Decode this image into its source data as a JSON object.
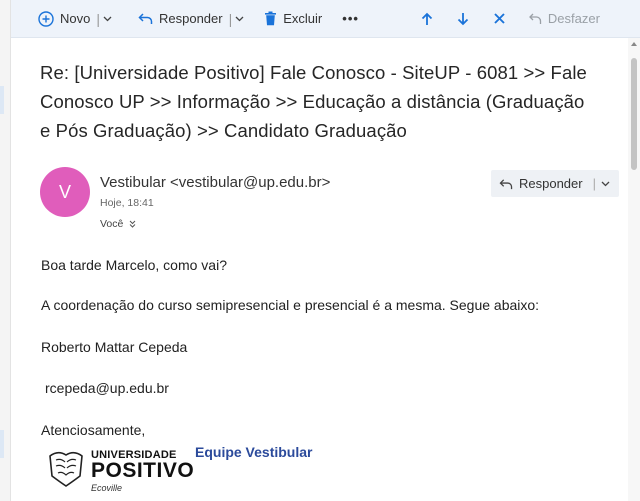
{
  "toolbar": {
    "new_label": "Novo",
    "reply_label": "Responder",
    "delete_label": "Excluir",
    "more_label": "•••",
    "undo_label": "Desfazer",
    "separator": "|"
  },
  "message": {
    "subject": "Re: [Universidade Positivo] Fale Conosco - SiteUP - 6081 >> Fale Conosco UP >> Informação >> Educação a distância (Graduação e Pós Graduação) >> Candidato Graduação",
    "avatar_initial": "V",
    "avatar_color": "#e05dbb",
    "sender": "Vestibular <vestibular@up.edu.br>",
    "time": "Hoje, 18:41",
    "to": "Você",
    "reply_button_label": "Responder"
  },
  "body": {
    "greeting": "Boa tarde Marcelo, como vai?",
    "paragraph": "A coordenação do curso semipresencial e presencial é a mesma. Segue abaixo:",
    "contact_name": "Roberto Mattar Cepeda",
    "contact_email": "rcepeda@up.edu.br",
    "closing": "Atenciosamente,"
  },
  "signature": {
    "logo_line1": "UNIVERSIDADE",
    "logo_line2": "POSITIVO",
    "logo_line3": "Ecoville",
    "team": "Equipe Vestibular",
    "team_color": "#2b4a9b"
  },
  "colors": {
    "accent": "#1a73d9",
    "toolbar_bg": "#eef3fa"
  }
}
